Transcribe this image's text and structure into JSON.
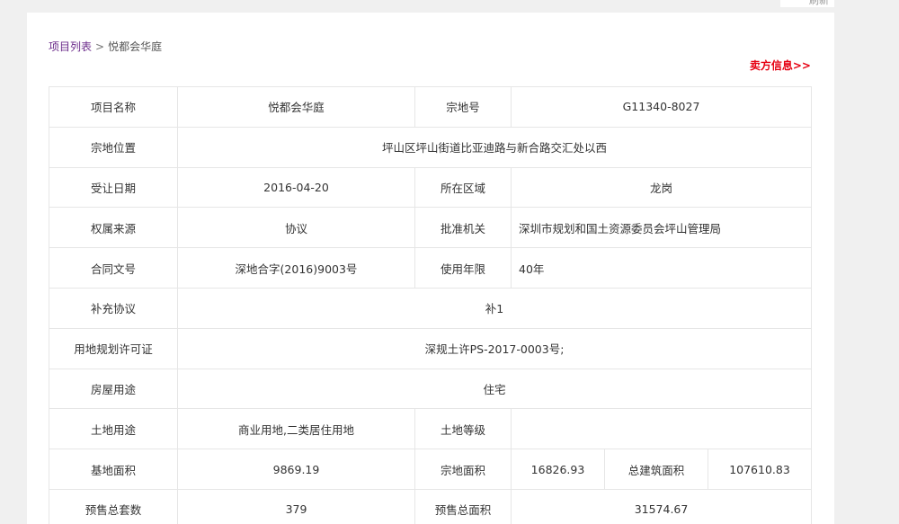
{
  "top_strip_text": "刷新",
  "breadcrumb": {
    "root": "项目列表",
    "separator": ">",
    "current": "悦都会华庭"
  },
  "seller_link": "卖方信息>>",
  "rows": {
    "r1": {
      "l1": "项目名称",
      "v1": "悦都会华庭",
      "l2": "宗地号",
      "v2": "G11340-8027"
    },
    "r2": {
      "l1": "宗地位置",
      "v1": "坪山区坪山街道比亚迪路与新合路交汇处以西"
    },
    "r3": {
      "l1": "受让日期",
      "v1": "2016-04-20",
      "l2": "所在区域",
      "v2": "龙岗"
    },
    "r4": {
      "l1": "权属来源",
      "v1": "协议",
      "l2": "批准机关",
      "v2": "深圳市规划和国土资源委员会坪山管理局"
    },
    "r5": {
      "l1": "合同文号",
      "v1": "深地合字(2016)9003号",
      "l2": "使用年限",
      "v2": "40年"
    },
    "r6": {
      "l1": "补充协议",
      "v1": "补1"
    },
    "r7": {
      "l1": "用地规划许可证",
      "v1": "深规土许PS-2017-0003号;"
    },
    "r8": {
      "l1": "房屋用途",
      "v1": "住宅"
    },
    "r9": {
      "l1": "土地用途",
      "v1": "商业用地,二类居住用地",
      "l2": "土地等级",
      "v2": ""
    },
    "r10": {
      "l1": "基地面积",
      "v1": "9869.19",
      "l2": "宗地面积",
      "v2": "16826.93",
      "l3": "总建筑面积",
      "v3": "107610.83"
    },
    "r11": {
      "l1": "预售总套数",
      "v1": "379",
      "l2": "预售总面积",
      "v2": "31574.67"
    }
  }
}
